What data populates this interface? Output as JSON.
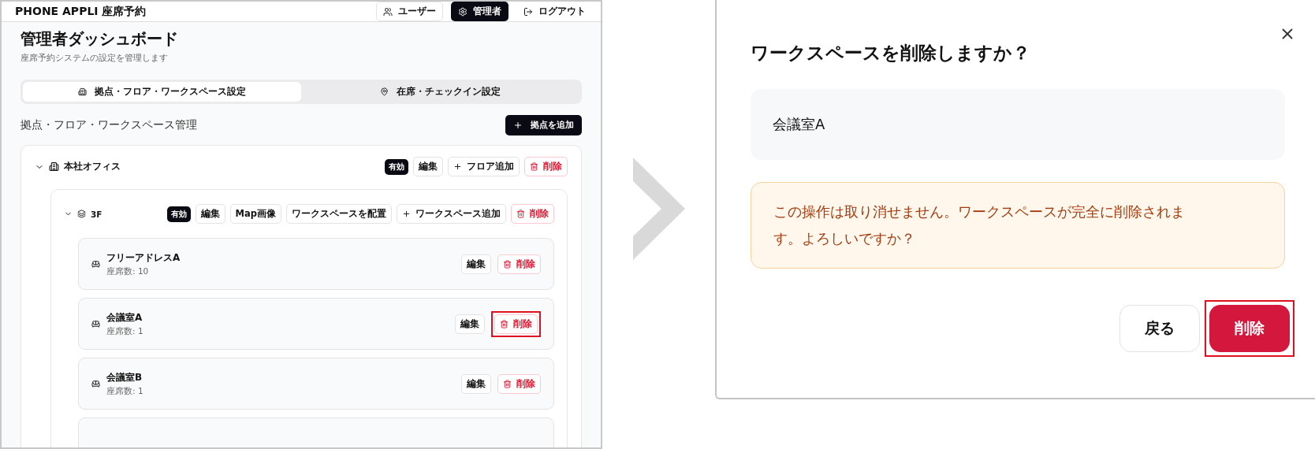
{
  "app": {
    "title": "PHONE APPLI 座席予約",
    "nav": [
      {
        "label": "ユーザー",
        "selected": false,
        "kind": "button"
      },
      {
        "label": "管理者",
        "selected": true,
        "kind": "button"
      },
      {
        "label": "ログアウト",
        "selected": false,
        "kind": "link"
      }
    ],
    "dashboard": {
      "title": "管理者ダッシュボード",
      "subtitle": "座席予約システムの設定を管理します"
    },
    "tabs": [
      {
        "label": "拠点・フロア・ワークスペース設定",
        "selected": true
      },
      {
        "label": "在席・チェックイン設定",
        "selected": false
      }
    ],
    "section": {
      "title": "拠点・フロア・ワークスペース管理",
      "add_button": "拠点を追加"
    },
    "sites": [
      {
        "name": "本社オフィス",
        "status": "有効",
        "expanded": true,
        "actions": [
          {
            "label": "編集",
            "kind": "default"
          },
          {
            "label": "フロア追加",
            "kind": "add"
          },
          {
            "label": "削除",
            "kind": "danger"
          }
        ],
        "floors": [
          {
            "name": "3F",
            "status": "有効",
            "expanded": true,
            "actions": [
              {
                "label": "編集",
                "kind": "default"
              },
              {
                "label": "Map画像",
                "kind": "default"
              },
              {
                "label": "ワークスペースを配置",
                "kind": "default"
              },
              {
                "label": "ワークスペース追加",
                "kind": "add"
              },
              {
                "label": "削除",
                "kind": "danger"
              }
            ],
            "workspaces": [
              {
                "name": "フリーアドレスA",
                "seats": "座席数: 10",
                "actions": [
                  {
                    "label": "編集",
                    "kind": "default",
                    "highlighted": false
                  },
                  {
                    "label": "削除",
                    "kind": "danger",
                    "highlighted": false
                  }
                ]
              },
              {
                "name": "会議室A",
                "seats": "座席数: 1",
                "actions": [
                  {
                    "label": "編集",
                    "kind": "default",
                    "highlighted": false
                  },
                  {
                    "label": "削除",
                    "kind": "danger",
                    "highlighted": true
                  }
                ]
              },
              {
                "name": "会議室B",
                "seats": "座席数: 1",
                "actions": [
                  {
                    "label": "編集",
                    "kind": "default",
                    "highlighted": false
                  },
                  {
                    "label": "削除",
                    "kind": "danger",
                    "highlighted": false
                  }
                ]
              }
            ]
          }
        ]
      }
    ]
  },
  "dialog": {
    "title": "ワークスペースを削除しますか？",
    "item_name": "会議室A",
    "warning": "この操作は取り消せません。ワークスペースが完全に削除されます。よろしいですか？",
    "buttons": [
      {
        "label": "戻る",
        "kind": "cancel",
        "highlighted": false
      },
      {
        "label": "削除",
        "kind": "danger",
        "highlighted": true
      }
    ]
  }
}
